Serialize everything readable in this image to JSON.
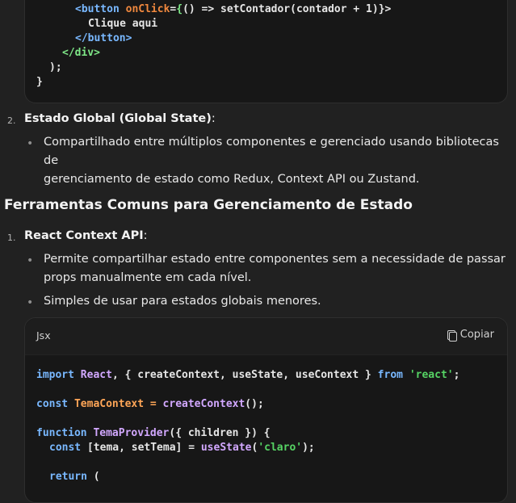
{
  "code_top": {
    "lines": [
      [
        "<button ",
        "onClick",
        "=",
        "{",
        "() => setContador(contador + 1)",
        "}>"
      ],
      [
        "Clique aqui"
      ],
      [
        "</button>"
      ],
      [
        "</div>"
      ],
      [
        ");"
      ],
      [
        "}"
      ]
    ]
  },
  "list1": {
    "item2_number": "2.",
    "item2_title": "Estado Global (Global State)",
    "item2_colon": ":",
    "item2_bullets": [
      "Compartilhado entre múltiplos componentes e gerenciado usando bibliotecas de",
      "gerenciamento de estado como Redux, Context API ou Zustand."
    ]
  },
  "section_heading": "Ferramentas Comuns para Gerenciamento de Estado",
  "list2": {
    "item1_number": "1.",
    "item1_title": "React Context API",
    "item1_colon": ":",
    "bullet1_lines": [
      "Permite compartilhar estado entre componentes sem a necessidade de passar",
      "props manualmente em cada nível."
    ],
    "bullet2": "Simples de usar para estados globais menores."
  },
  "code_block": {
    "language": "Jsx",
    "copy_label": "Copiar",
    "line1": {
      "a": "import",
      "b": " React",
      "c": ", { createContext, useState, useContext } ",
      "d": "from",
      "e": " ",
      "f": "'react'",
      "g": ";"
    },
    "line2": {
      "a": "const",
      "b": " TemaContext = ",
      "c": "createContext",
      "d": "();"
    },
    "line3": {
      "a": "function",
      "b": " TemaProvider",
      "c": "({ children }) {"
    },
    "line4": {
      "a": "const",
      "b": " [tema, setTema] = ",
      "c": "useState",
      "d": "(",
      "e": "'claro'",
      "f": ");"
    },
    "line5": {
      "a": "return",
      "b": " ("
    }
  },
  "colors": {
    "background": "#212121",
    "code_background": "#171717",
    "keyword": "#79b8ff",
    "string": "#56d364",
    "function": "#d2a8ff"
  }
}
